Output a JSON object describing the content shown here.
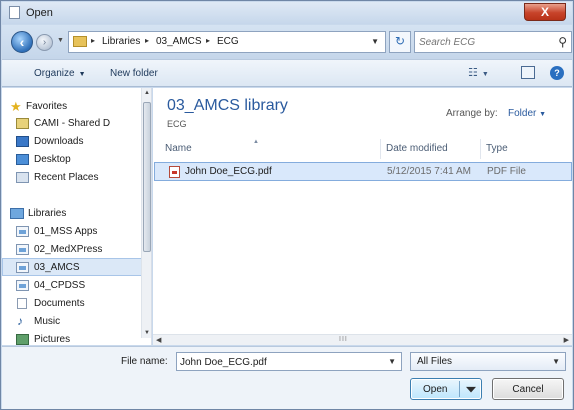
{
  "window": {
    "title": "Open",
    "close_glyph": "X"
  },
  "nav": {
    "back_icon": "back-arrow-icon",
    "forward_icon": "forward-arrow-icon"
  },
  "address": {
    "crumbs": [
      "Libraries",
      "03_AMCS",
      "ECG"
    ],
    "separator": "▸"
  },
  "search": {
    "placeholder": "Search ECG"
  },
  "toolbar": {
    "organize_label": "Organize",
    "new_folder_label": "New folder"
  },
  "sidebar": {
    "favorites_label": "Favorites",
    "favorites": [
      "CAMI - Shared D",
      "Downloads",
      "Desktop",
      "Recent Places"
    ],
    "libraries_label": "Libraries",
    "libraries": [
      "01_MSS Apps",
      "02_MedXPress",
      "03_AMCS",
      "04_CPDSS",
      "Documents",
      "Music",
      "Pictures"
    ],
    "selected": "03_AMCS"
  },
  "content": {
    "library_title": "03_AMCS library",
    "library_subtitle": "ECG",
    "arrange_label": "Arrange by:",
    "arrange_value": "Folder",
    "columns": {
      "name": "Name",
      "date_modified": "Date modified",
      "type": "Type"
    },
    "files": [
      {
        "name": "John Doe_ECG.pdf",
        "date_modified": "5/12/2015 7:41 AM",
        "type": "PDF File"
      }
    ]
  },
  "footer": {
    "file_name_label": "File name:",
    "file_name_value": "John Doe_ECG.pdf",
    "file_type": "All Files",
    "open_label": "Open",
    "cancel_label": "Cancel"
  },
  "colors": {
    "accent": "#2a5a9e",
    "selection": "#d9e8fb",
    "close": "#c7432a"
  }
}
